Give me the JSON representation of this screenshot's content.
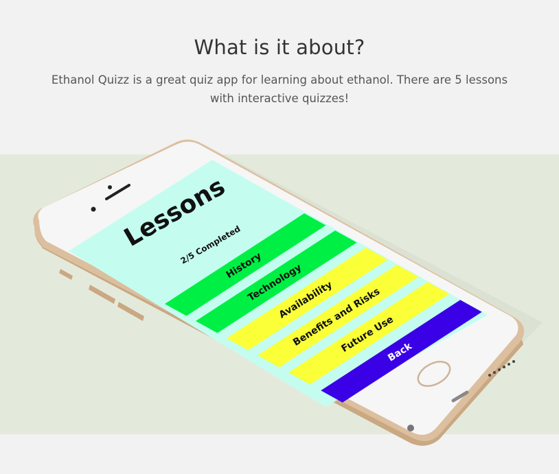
{
  "section": {
    "title": "What is it about?",
    "description": "Ethanol Quizz is a great quiz app for learning about ethanol. There are 5 lessons with interactive quizzes!"
  },
  "app_screen": {
    "heading": "Lessons",
    "progress": "2/5 Completed",
    "lessons": [
      {
        "label": "History",
        "color": "#00ef45"
      },
      {
        "label": "Technology",
        "color": "#00ef45"
      },
      {
        "label": "Availability",
        "color": "#faff38"
      },
      {
        "label": "Benefits and Risks",
        "color": "#faff38"
      },
      {
        "label": "Future Use",
        "color": "#faff38"
      }
    ],
    "back_label": "Back",
    "back_color": "#3a00e6",
    "background_color": "#c4fdf0"
  },
  "colors": {
    "page_bg": "#f2f2f2",
    "band_bg": "#e4eadb",
    "phone_gold": "#e2c8ab",
    "phone_face": "#f7f7f7"
  }
}
